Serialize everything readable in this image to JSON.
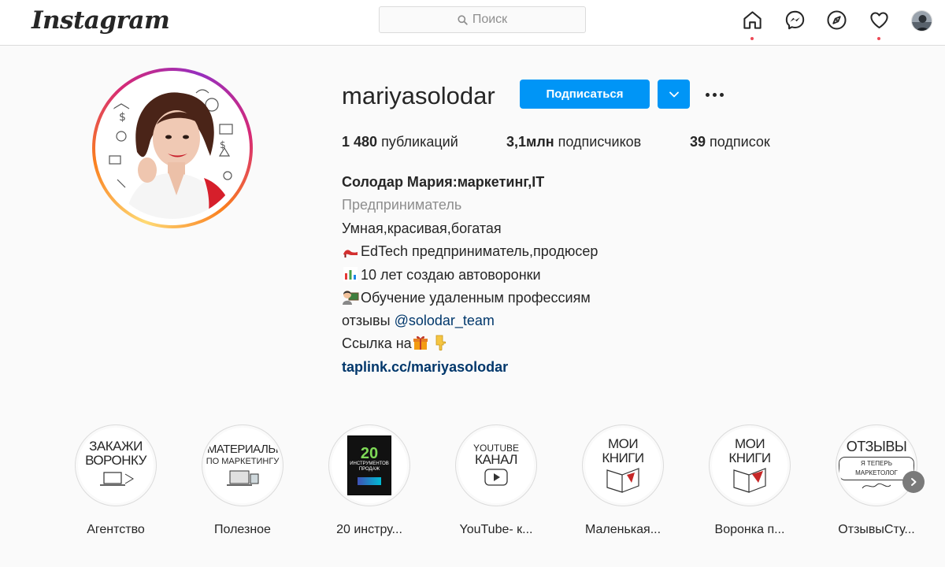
{
  "nav": {
    "logo": "Instagram",
    "search_placeholder": "Поиск"
  },
  "profile": {
    "username": "mariyasolodar",
    "follow_label": "Подписаться",
    "stats": {
      "posts_count": "1 480",
      "posts_label": "публикаций",
      "followers_count": "3,1млн",
      "followers_label": "подписчиков",
      "following_count": "39",
      "following_label": "подписок"
    },
    "bio": {
      "full_name": "Солодар Мария:маркетинг,IT",
      "category": "Предприниматель",
      "line1": "Умная,красивая,богатая",
      "line2": "EdTech предприниматель,продюсер",
      "line3": "10 лет создаю автоворонки",
      "line4": "Обучение удаленным профессиям",
      "line5_prefix": "отзывы ",
      "line5_mention": "@solodar_team",
      "line6": "Ссылка на",
      "link": "taplink.cc/mariyasolodar"
    }
  },
  "highlights": [
    {
      "label": "Агентство",
      "cover_line1": "ЗАКАЖИ",
      "cover_line2": "ВОРОНКУ"
    },
    {
      "label": "Полезное",
      "cover_line1": "МАТЕРИАЛЫ",
      "cover_line2": "ПО МАРКЕТИНГУ"
    },
    {
      "label": "20 инстру...",
      "cover_line1": "20",
      "cover_line2": "ИНСТРУМЕНТОВ ПРОДАЖ"
    },
    {
      "label": "YouTube- к...",
      "cover_line1": "YOUTUBE",
      "cover_line2": "КАНАЛ"
    },
    {
      "label": "Маленькая...",
      "cover_line1": "МОИ",
      "cover_line2": "КНИГИ"
    },
    {
      "label": "Воронка п...",
      "cover_line1": "МОИ",
      "cover_line2": "КНИГИ"
    },
    {
      "label": "ОтзывыСту...",
      "cover_line1": "ОТЗЫВЫ",
      "cover_line2": "Я ТЕПЕРЬ МАРКЕТОЛОГ"
    }
  ],
  "colors": {
    "accent": "#0095f6",
    "link": "#00376b",
    "notification": "#ed4956"
  },
  "icons": [
    "home-icon",
    "messenger-icon",
    "explore-icon",
    "heart-icon",
    "search-icon",
    "chevron-down-icon",
    "more-icon",
    "chevron-right-icon"
  ]
}
